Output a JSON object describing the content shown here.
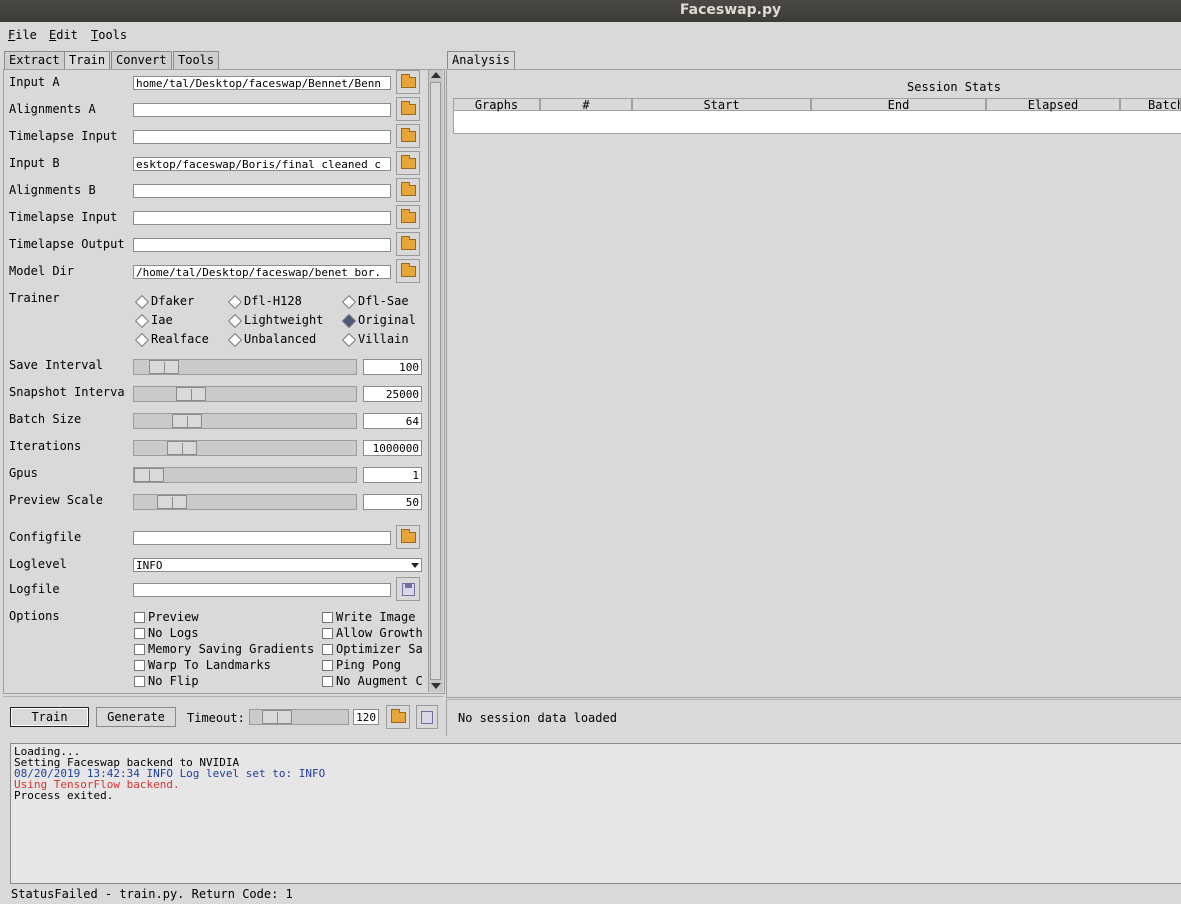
{
  "window": {
    "title": "Faceswap.py"
  },
  "menu": [
    {
      "label": "File",
      "mnemonic": "F",
      "rest": "ile"
    },
    {
      "label": "Edit",
      "mnemonic": "E",
      "rest": "dit"
    },
    {
      "label": "Tools",
      "mnemonic": "T",
      "rest": "ools"
    }
  ],
  "left_tabs": [
    "Extract",
    "Train",
    "Convert",
    "Tools"
  ],
  "right_tabs": [
    "Analysis"
  ],
  "fields": [
    {
      "label": "Input A",
      "value": "home/tal/Desktop/faceswap/Bennet/Benn"
    },
    {
      "label": "Alignments A",
      "value": ""
    },
    {
      "label": "Timelapse Input",
      "value": ""
    },
    {
      "label": "Input B",
      "value": "esktop/faceswap/Boris/final_cleaned_c"
    },
    {
      "label": "Alignments B",
      "value": ""
    },
    {
      "label": "Timelapse Input",
      "value": ""
    },
    {
      "label": "Timelapse Output",
      "value": ""
    },
    {
      "label": "Model Dir",
      "value": "/home/tal/Desktop/faceswap/benet_bor."
    }
  ],
  "trainer": {
    "label": "Trainer",
    "options": [
      "Dfaker",
      "Dfl-H128",
      "Dfl-Sae",
      "Iae",
      "Lightweight",
      "Original",
      "Realface",
      "Unbalanced",
      "Villain"
    ],
    "selected": "Original"
  },
  "sliders": [
    {
      "label": "Save Interval",
      "value": "100",
      "level": 0.08
    },
    {
      "label": "Snapshot Interva",
      "value": "25000",
      "level": 0.22
    },
    {
      "label": "Batch Size",
      "value": "64",
      "level": 0.2
    },
    {
      "label": "Iterations",
      "value": "1000000",
      "level": 0.17
    },
    {
      "label": "Gpus",
      "value": "1",
      "level": 0.0
    },
    {
      "label": "Preview Scale",
      "value": "50",
      "level": 0.12
    }
  ],
  "configfile": {
    "label": "Configfile",
    "value": ""
  },
  "loglevel": {
    "label": "Loglevel",
    "value": "INFO"
  },
  "logfile": {
    "label": "Logfile",
    "value": ""
  },
  "options": {
    "label": "Options",
    "items": [
      "Preview",
      "Write Image",
      "No Logs",
      "Allow Growth",
      "Memory Saving Gradients",
      "Optimizer Sa",
      "Warp To Landmarks",
      "Ping Pong",
      "No Flip",
      "No Augment C"
    ]
  },
  "actions": {
    "train": "Train",
    "generate": "Generate",
    "timeout_label": "Timeout:",
    "timeout_value": "120"
  },
  "session": {
    "title": "Session Stats",
    "columns": [
      "Graphs",
      "#",
      "Start",
      "End",
      "Elapsed",
      "Batch"
    ],
    "message": "No session data loaded"
  },
  "console": [
    {
      "text": "Loading...",
      "color": "#000000"
    },
    {
      "text": "Setting Faceswap backend to NVIDIA",
      "color": "#000000"
    },
    {
      "text": "08/20/2019 13:42:34 INFO     Log level set to: INFO",
      "color": "#1f3f9f"
    },
    {
      "text": "Using TensorFlow backend.",
      "color": "#e03030"
    },
    {
      "text": "Process exited.",
      "color": "#000000"
    }
  ],
  "status": "StatusFailed - train.py. Return Code: 1"
}
